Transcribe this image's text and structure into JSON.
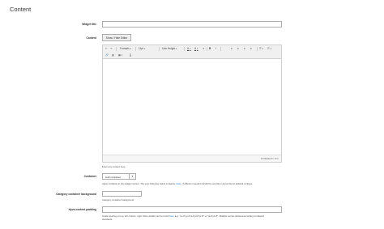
{
  "page": {
    "title": "Content"
  },
  "fields": {
    "widget_title": {
      "label": "Widget title",
      "value": ""
    },
    "content": {
      "label": "Content",
      "toggle_button": "Show / Hide Editor",
      "toolbar_row1": {
        "undo": "↶",
        "redo": "↷",
        "formats": "Formats",
        "font_size": "11pt",
        "line_height": "Line Height",
        "text_color": "A",
        "bg_color": "A",
        "clear": "✕",
        "bold": "B",
        "italic": "I",
        "align_left": "≡",
        "align_center": "≡",
        "align_right": "≡",
        "justify": "≡",
        "bullets": "☰",
        "numbered": "☰"
      },
      "toolbar_row2": {
        "link": "🔗",
        "image": "▧",
        "table": "▦",
        "source": "{}"
      },
      "powered_by": "POWERED BY TINY",
      "hint": "Enter any content here."
    },
    "container": {
      "label": "Container",
      "selected": "Add container",
      "note_before": "Apply container in the widget content. The your following native container ",
      "note_link": "class",
      "note_after": ". If different needed should be override in Hyva theme tailwind.config.js"
    },
    "category_bg": {
      "label": "Category container background",
      "value": "",
      "note": "Category container background"
    },
    "hyva_padding": {
      "label": "Hyva content padding",
      "value": "",
      "note1_before": "Inside spacing on top, left, bottom, right. More details can be found ",
      "note1_link": "here",
      "note1_after": " E.g. \"px-8 py-8 pt-8 pl-8 pr-8\" or \"pt-6 pb-8\". Multiple entries allowed according to tailwind",
      "note2": "standards."
    }
  }
}
